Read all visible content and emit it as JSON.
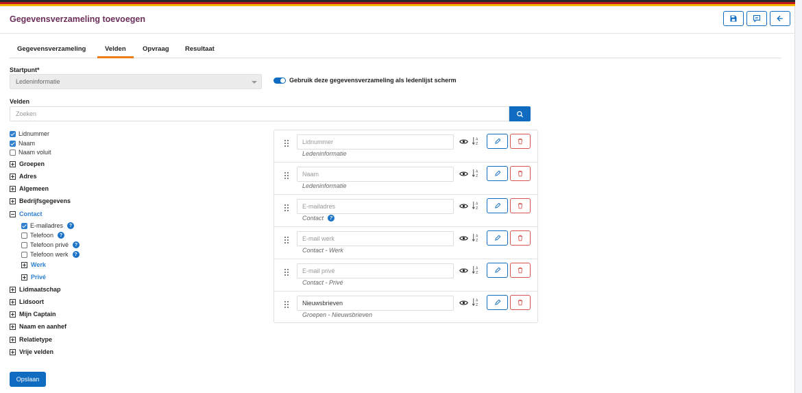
{
  "header": {
    "title": "Gegevensverzameling toevoegen",
    "accent_color": "#6b2f5a",
    "buttons": [
      {
        "name": "save-icon"
      },
      {
        "name": "comment-icon"
      },
      {
        "name": "arrow-left-icon"
      }
    ]
  },
  "tabs": [
    {
      "label": "Gegevensverzameling",
      "active": false
    },
    {
      "label": "Velden",
      "active": true
    },
    {
      "label": "Opvraag",
      "active": false
    },
    {
      "label": "Resultaat",
      "active": false
    }
  ],
  "startpunt": {
    "label": "Startpunt*",
    "value": "Ledeninformatie"
  },
  "toggle": {
    "on": true,
    "label": "Gebruik deze gegevensverzameling als ledenlijst scherm"
  },
  "velden": {
    "label": "Velden",
    "search_placeholder": "Zoeken"
  },
  "tree": {
    "top_items": [
      {
        "label": "Lidnummer",
        "checked": true
      },
      {
        "label": "Naam",
        "checked": true
      },
      {
        "label": "Naam voluit",
        "checked": false
      }
    ],
    "groups_before": [
      "Groepen",
      "Adres",
      "Algemeen",
      "Bedrijfsgegevens"
    ],
    "contact": {
      "label": "Contact",
      "items": [
        {
          "label": "E-mailadres",
          "checked": true,
          "help": true
        },
        {
          "label": "Telefoon",
          "checked": false,
          "help": true
        },
        {
          "label": "Telefoon privé",
          "checked": false,
          "help": true
        },
        {
          "label": "Telefoon werk",
          "checked": false,
          "help": true
        }
      ],
      "subgroups": [
        "Werk",
        "Privé"
      ]
    },
    "groups_after": [
      "Lidmaatschap",
      "Lidsoort",
      "Mijn Captain",
      "Naam en aanhef",
      "Relatietype",
      "Vrije velden"
    ]
  },
  "fields": [
    {
      "placeholder": "Lidnummer",
      "value": "",
      "source": "Ledeninformatie",
      "help": false
    },
    {
      "placeholder": "Naam",
      "value": "",
      "source": "Ledeninformatie",
      "help": false
    },
    {
      "placeholder": "E-mailadres",
      "value": "",
      "source": "Contact",
      "help": true
    },
    {
      "placeholder": "E-mail werk",
      "value": "",
      "source": "Contact - Werk",
      "help": false
    },
    {
      "placeholder": "E-mail privé",
      "value": "",
      "source": "Contact - Privé",
      "help": false
    },
    {
      "placeholder": "",
      "value": "Nieuwsbrieven",
      "source": "Groepen - Nieuwsbrieven",
      "help": false
    }
  ],
  "save_label": "Opslaan",
  "help_glyph": "?"
}
